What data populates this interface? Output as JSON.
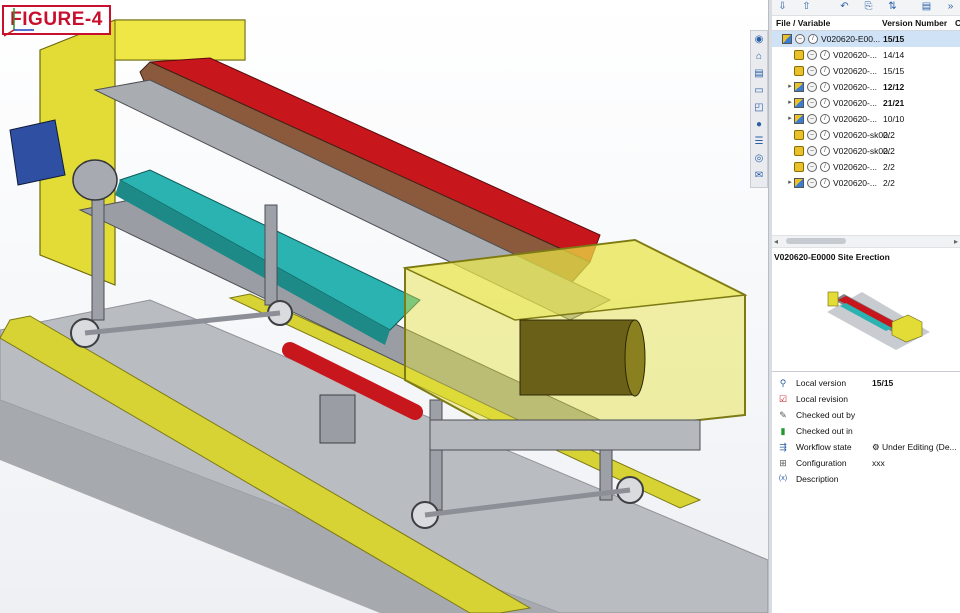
{
  "figure_label": "FIGURE-4",
  "columns": {
    "file_variable": "File / Variable",
    "version_number": "Version Number",
    "extra": "C"
  },
  "tree": [
    {
      "name": "V020620-E00...",
      "version": "15/15",
      "bold": true,
      "selected": true,
      "expandable": false,
      "indent": 0,
      "type": "assembly"
    },
    {
      "name": "V020620-...",
      "version": "14/14",
      "bold": false,
      "selected": false,
      "expandable": false,
      "indent": 1,
      "type": "part"
    },
    {
      "name": "V020620-...",
      "version": "15/15",
      "bold": false,
      "selected": false,
      "expandable": false,
      "indent": 1,
      "type": "part"
    },
    {
      "name": "V020620-...",
      "version": "12/12",
      "bold": true,
      "selected": false,
      "expandable": true,
      "indent": 1,
      "type": "assembly"
    },
    {
      "name": "V020620-...",
      "version": "21/21",
      "bold": true,
      "selected": false,
      "expandable": true,
      "indent": 1,
      "type": "assembly"
    },
    {
      "name": "V020620-...",
      "version": "10/10",
      "bold": false,
      "selected": false,
      "expandable": true,
      "indent": 1,
      "type": "assembly"
    },
    {
      "name": "V020620-sk00...",
      "version": "2/2",
      "bold": false,
      "selected": false,
      "expandable": false,
      "indent": 1,
      "type": "part"
    },
    {
      "name": "V020620-sk00...",
      "version": "2/2",
      "bold": false,
      "selected": false,
      "expandable": false,
      "indent": 1,
      "type": "part"
    },
    {
      "name": "V020620-...",
      "version": "2/2",
      "bold": false,
      "selected": false,
      "expandable": false,
      "indent": 1,
      "type": "part"
    },
    {
      "name": "V020620-...",
      "version": "2/2",
      "bold": false,
      "selected": false,
      "expandable": true,
      "indent": 1,
      "type": "assembly"
    }
  ],
  "preview": {
    "title": "V020620-E0000 Site Erection"
  },
  "properties": [
    {
      "label": "Local version",
      "value": "15/15",
      "bold": true,
      "icon": "version-icon"
    },
    {
      "label": "Local revision",
      "value": "",
      "bold": false,
      "icon": "revision-check-icon"
    },
    {
      "label": "Checked out by",
      "value": "",
      "bold": false,
      "icon": "checkout-user-icon"
    },
    {
      "label": "Checked out in",
      "value": "",
      "bold": false,
      "icon": "checkout-location-icon"
    },
    {
      "label": "Workflow state",
      "value": "Under Editing (De...",
      "bold": false,
      "icon": "workflow-icon"
    },
    {
      "label": "Configuration",
      "value": "xxx",
      "bold": false,
      "icon": "configuration-icon"
    },
    {
      "label": "Description",
      "value": "",
      "bold": false,
      "icon": "variable-icon"
    }
  ],
  "colors": {
    "frame_yellow": "#e8e23a",
    "panel_red": "#c8161d",
    "conveyor_teal": "#2ab3b0",
    "structure_grey": "#9a9ea4",
    "selection_blue": "#cfe2f6",
    "label_red": "#c8102e"
  }
}
